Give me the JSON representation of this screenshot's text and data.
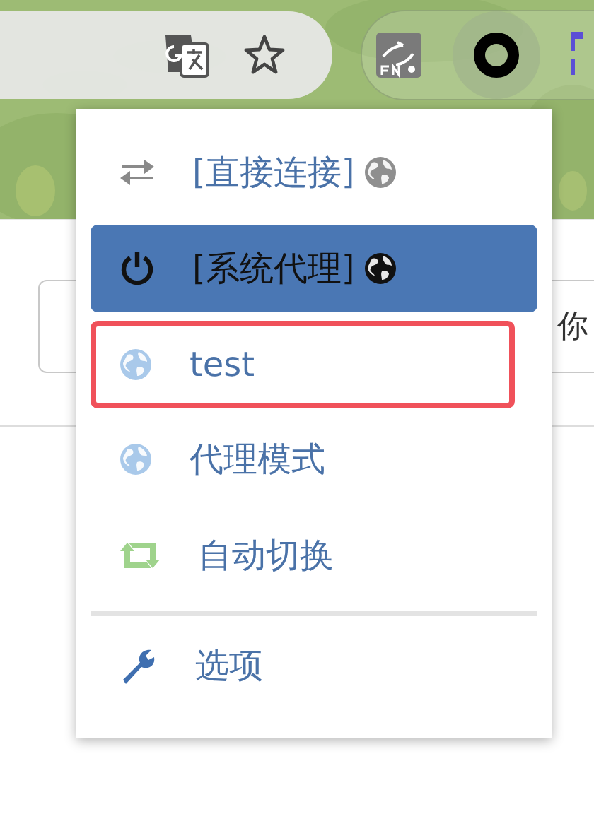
{
  "toolbar": {
    "extensions_active": true
  },
  "menu": {
    "items": [
      {
        "kind": "direct",
        "label": "[直接连接]",
        "globe": true,
        "color": "#8f8f8f",
        "selected": false,
        "outlined": false
      },
      {
        "kind": "system",
        "label": "[系统代理]",
        "globe": true,
        "color": "#111111",
        "selected": true,
        "outlined": false
      },
      {
        "kind": "profile",
        "label": "test",
        "globe": false,
        "color": "#a9c9ea",
        "selected": false,
        "outlined": true
      },
      {
        "kind": "profile",
        "label": "代理模式",
        "globe": false,
        "color": "#a9c9ea",
        "selected": false,
        "outlined": false
      },
      {
        "kind": "auto",
        "label": "自动切换",
        "globe": false,
        "selected": false,
        "outlined": false
      },
      {
        "kind": "divider"
      },
      {
        "kind": "options",
        "label": "选项",
        "globe": false,
        "selected": false,
        "outlined": false
      }
    ]
  },
  "page": {
    "field_text": "你"
  }
}
